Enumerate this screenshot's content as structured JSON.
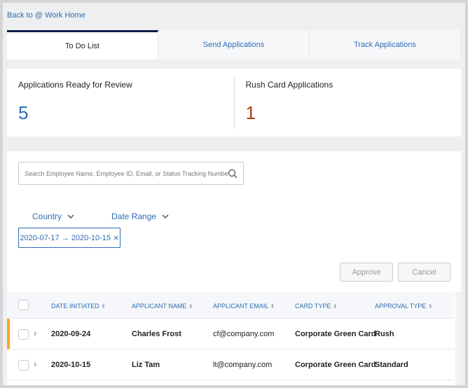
{
  "header": {
    "back_link": "Back to @ Work Home"
  },
  "tabs": [
    {
      "label": "To Do List",
      "active": true
    },
    {
      "label": "Send Applications"
    },
    {
      "label": "Track Applications"
    }
  ],
  "summary": [
    {
      "title": "Applications Ready for Review",
      "count": "5",
      "color": "#2f6cb3"
    },
    {
      "title": "Rush Card Applications",
      "count": "1",
      "color": "#b5371c"
    }
  ],
  "search": {
    "placeholder": "Search Employee Name, Employee ID, Email, or Status Tracking Number",
    "value": ""
  },
  "filters": {
    "country": "Country",
    "date_range": "Date Range",
    "chip": "2020-07-17 → 2020-10-15",
    "chip_close": "×"
  },
  "actions": {
    "approve": "Approve",
    "cancel": "Cancel"
  },
  "table": {
    "columns": [
      "DATE INITIATED",
      "APPLICANT NAME",
      "APPLICANT EMAIL",
      "CARD TYPE",
      "APPROVAL TYPE"
    ],
    "rows": [
      {
        "date": "2020-09-24",
        "name": "Charles Frost",
        "email": "cf@company.com",
        "card": "Corporate Green Card",
        "approval": "Rush",
        "highlight": "#f5a623"
      },
      {
        "date": "2020-10-15",
        "name": "Liz Tam",
        "email": "lt@company.com",
        "card": "Corporate Green Card",
        "approval": "Standard"
      }
    ]
  }
}
